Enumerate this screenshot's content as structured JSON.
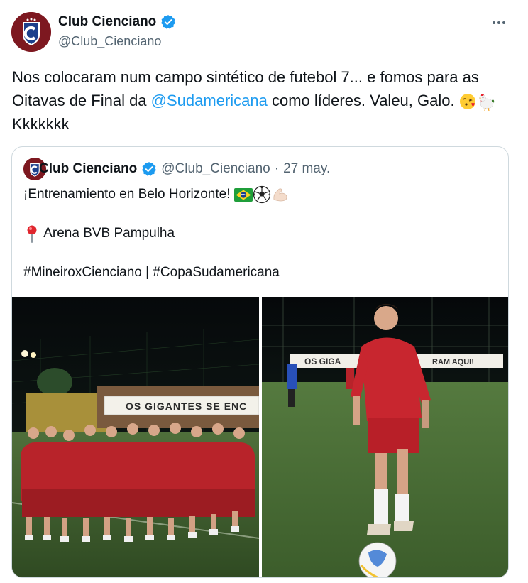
{
  "tweet": {
    "author_name": "Club Cienciano",
    "author_handle": "@Club_Cienciano",
    "text_part1": "Nos colocaram num campo sintético de futebol 7... e fomos para as Oitavas de Final da ",
    "mention": "@Sudamericana",
    "text_part2": " como líderes. Valeu, Galo. ",
    "text_part3": " Kkkkkkk"
  },
  "quoted": {
    "author_name": "Club Cienciano",
    "author_handle": "@Club_Cienciano",
    "separator": "·",
    "date": "27 may.",
    "line1": "¡Entrenamiento en Belo Horizonte! ",
    "line2": "Arena BVB Pampulha",
    "line3": "#MineiroxCienciano | #CopaSudamericana",
    "banner_left": "OS GIGANTES SE ENC",
    "banner_right": "OS GIGA",
    "banner_right2": "RAM AQUI!"
  },
  "icons": {
    "avatar": "club-crest-icon",
    "verified": "verified-badge-icon",
    "more": "more-options-icon",
    "pin": "round-pushpin-icon",
    "brazil": "brazil-flag-icon",
    "ball": "soccer-ball-icon",
    "muscle": "flexed-biceps-icon",
    "kiss": "face-blowing-kiss-icon",
    "rooster": "rooster-icon"
  },
  "colors": {
    "link": "#1d9bf0",
    "secondary": "#536471",
    "border": "#cfd9de",
    "club_red": "#8a1b24"
  }
}
